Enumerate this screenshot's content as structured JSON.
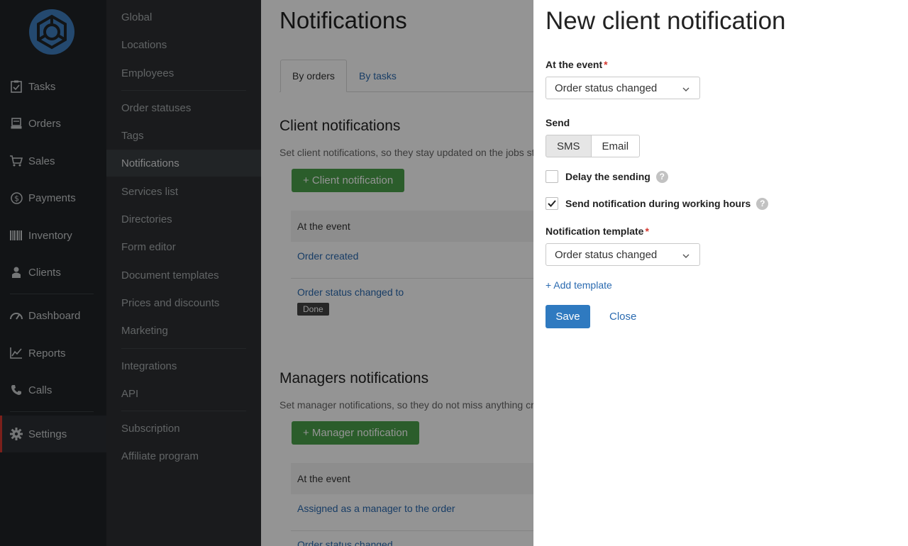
{
  "nav": {
    "items": [
      {
        "label": "Tasks",
        "icon": "clipboard-icon"
      },
      {
        "label": "Orders",
        "icon": "register-icon"
      },
      {
        "label": "Sales",
        "icon": "cart-icon"
      },
      {
        "label": "Payments",
        "icon": "dollar-icon"
      },
      {
        "label": "Inventory",
        "icon": "barcode-icon"
      },
      {
        "label": "Clients",
        "icon": "person-icon"
      },
      {
        "label": "Dashboard",
        "icon": "gauge-icon"
      },
      {
        "label": "Reports",
        "icon": "chart-icon"
      },
      {
        "label": "Calls",
        "icon": "phone-icon"
      },
      {
        "label": "Settings",
        "icon": "gear-icon"
      }
    ]
  },
  "submenu": {
    "items": [
      "Global",
      "Locations",
      "Employees",
      "Order statuses",
      "Tags",
      "Notifications",
      "Services list",
      "Directories",
      "Form editor",
      "Document templates",
      "Prices and discounts",
      "Marketing",
      "Integrations",
      "API",
      "Subscription",
      "Affiliate program"
    ]
  },
  "main": {
    "title": "Notifications",
    "tabs": [
      "By orders",
      "By tasks"
    ],
    "client": {
      "title": "Client notifications",
      "desc": "Set client notifications, so they stay updated on the jobs sta",
      "button": "+ Client notification",
      "col": "At the event",
      "rows": [
        "Order created",
        "Order status changed to"
      ],
      "tag": "Done"
    },
    "managers": {
      "title": "Managers notifications",
      "desc": "Set manager notifications, so they do not miss anything cru",
      "button": "+ Manager notification",
      "col": "At the event",
      "rows": [
        "Assigned as a manager to the order",
        "Order status changed"
      ]
    }
  },
  "panel": {
    "title": "New client notification",
    "event_label": "At the event",
    "event_value": "Order status changed",
    "send_label": "Send",
    "send_options": [
      "SMS",
      "Email"
    ],
    "delay_label": "Delay the sending",
    "working_hours_label": "Send notification during working hours",
    "template_label": "Notification template",
    "template_value": "Order status changed",
    "add_template": "+ Add template",
    "save": "Save",
    "close": "Close",
    "required_mark": "*",
    "help_mark": "?"
  }
}
